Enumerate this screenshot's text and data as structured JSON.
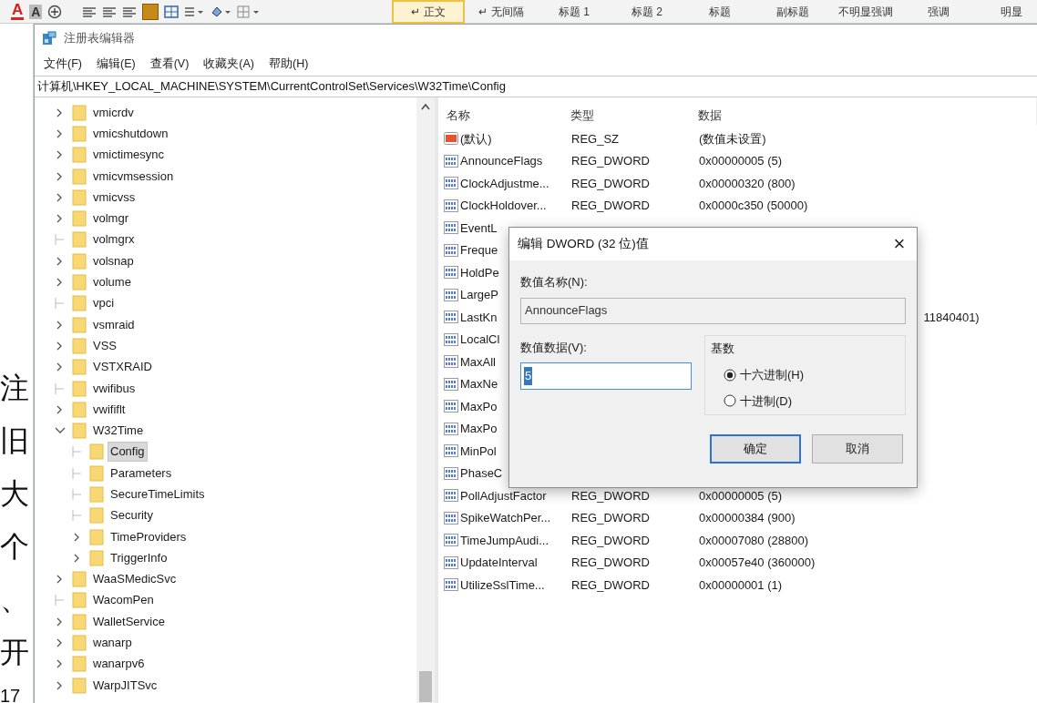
{
  "word_toolbar": {
    "glyph_buttons": [
      {
        "kind": "font-color",
        "glyph": "A"
      },
      {
        "kind": "shading",
        "glyph": "A"
      }
    ],
    "styles": [
      {
        "label": "正文",
        "prefix": "↵",
        "selected": true
      },
      {
        "label": "无间隔",
        "prefix": "↵",
        "selected": false
      },
      {
        "label": "标题 1",
        "selected": false
      },
      {
        "label": "标题 2",
        "selected": false
      },
      {
        "label": "标题",
        "selected": false
      },
      {
        "label": "副标题",
        "selected": false
      },
      {
        "label": "不明显强调",
        "selected": false
      },
      {
        "label": "强调",
        "selected": false
      },
      {
        "label": "明显",
        "selected": false
      }
    ]
  },
  "document_fragments": [
    "注",
    "旧",
    "大",
    "个",
    "、",
    "开",
    "17"
  ],
  "window": {
    "title": "注册表编辑器",
    "menu": [
      "文件(F)",
      "编辑(E)",
      "查看(V)",
      "收藏夹(A)",
      "帮助(H)"
    ],
    "address": "计算机\\HKEY_LOCAL_MACHINE\\SYSTEM\\CurrentControlSet\\Services\\W32Time\\Config",
    "tree": [
      {
        "kind": "branch",
        "label": "vmicrdv",
        "expanded": false,
        "selected": false
      },
      {
        "kind": "branch",
        "label": "vmicshutdown",
        "expanded": false,
        "selected": false
      },
      {
        "kind": "branch",
        "label": "vmictimesync",
        "expanded": false,
        "selected": false
      },
      {
        "kind": "branch",
        "label": "vmicvmsession",
        "expanded": false,
        "selected": false
      },
      {
        "kind": "branch",
        "label": "vmicvss",
        "expanded": false,
        "selected": false
      },
      {
        "kind": "branch",
        "label": "volmgr",
        "expanded": false,
        "selected": false
      },
      {
        "kind": "leaf",
        "label": "volmgrx",
        "selected": false
      },
      {
        "kind": "branch",
        "label": "volsnap",
        "expanded": false,
        "selected": false
      },
      {
        "kind": "branch",
        "label": "volume",
        "expanded": false,
        "selected": false
      },
      {
        "kind": "leaf",
        "label": "vpci",
        "selected": false
      },
      {
        "kind": "branch",
        "label": "vsmraid",
        "expanded": false,
        "selected": false
      },
      {
        "kind": "branch",
        "label": "VSS",
        "expanded": false,
        "selected": false
      },
      {
        "kind": "branch",
        "label": "VSTXRAID",
        "expanded": false,
        "selected": false
      },
      {
        "kind": "leaf",
        "label": "vwifibus",
        "selected": false
      },
      {
        "kind": "branch",
        "label": "vwififlt",
        "expanded": false,
        "selected": false
      },
      {
        "kind": "branch",
        "label": "W32Time",
        "expanded": true,
        "selected": false,
        "children": [
          {
            "kind": "leaf",
            "label": "Config",
            "selected": true
          },
          {
            "kind": "leaf",
            "label": "Parameters",
            "selected": false
          },
          {
            "kind": "leaf",
            "label": "SecureTimeLimits",
            "selected": false
          },
          {
            "kind": "leaf",
            "label": "Security",
            "selected": false
          },
          {
            "kind": "branch",
            "label": "TimeProviders",
            "expanded": false,
            "selected": false
          },
          {
            "kind": "branch",
            "label": "TriggerInfo",
            "expanded": false,
            "selected": false
          }
        ]
      },
      {
        "kind": "branch",
        "label": "WaaSMedicSvc",
        "expanded": false,
        "selected": false
      },
      {
        "kind": "leaf",
        "label": "WacomPen",
        "selected": false
      },
      {
        "kind": "branch",
        "label": "WalletService",
        "expanded": false,
        "selected": false
      },
      {
        "kind": "branch",
        "label": "wanarp",
        "expanded": false,
        "selected": false
      },
      {
        "kind": "branch",
        "label": "wanarpv6",
        "expanded": false,
        "selected": false
      },
      {
        "kind": "branch",
        "label": "WarpJITSvc",
        "expanded": false,
        "selected": false
      }
    ],
    "list": {
      "columns": [
        "名称",
        "类型",
        "数据"
      ],
      "rows": [
        {
          "kind": "string",
          "name": "(默认)",
          "type": "REG_SZ",
          "data": "(数值未设置)"
        },
        {
          "kind": "dword",
          "name": "AnnounceFlags",
          "type": "REG_DWORD",
          "data": "0x00000005 (5)"
        },
        {
          "kind": "dword",
          "name": "ClockAdjustme...",
          "type": "REG_DWORD",
          "data": "0x00000320 (800)"
        },
        {
          "kind": "dword",
          "name": "ClockHoldover...",
          "type": "REG_DWORD",
          "data": "0x0000c350 (50000)"
        },
        {
          "kind": "dword",
          "name": "EventL"
        },
        {
          "kind": "dword",
          "name": "Freque"
        },
        {
          "kind": "dword",
          "name": "HoldPe"
        },
        {
          "kind": "dword",
          "name": "LargeP"
        },
        {
          "kind": "dword",
          "name": "LastKn",
          "data_tail": "11840401)"
        },
        {
          "kind": "dword",
          "name": "LocalCl"
        },
        {
          "kind": "dword",
          "name": "MaxAll"
        },
        {
          "kind": "dword",
          "name": "MaxNe"
        },
        {
          "kind": "dword",
          "name": "MaxPo"
        },
        {
          "kind": "dword",
          "name": "MaxPo"
        },
        {
          "kind": "dword",
          "name": "MinPol"
        },
        {
          "kind": "dword",
          "name": "PhaseC"
        },
        {
          "kind": "dword",
          "name": "PollAdjustFactor",
          "type": "REG_DWORD",
          "data": "0x00000005 (5)"
        },
        {
          "kind": "dword",
          "name": "SpikeWatchPer...",
          "type": "REG_DWORD",
          "data": "0x00000384 (900)"
        },
        {
          "kind": "dword",
          "name": "TimeJumpAudi...",
          "type": "REG_DWORD",
          "data": "0x00007080 (28800)"
        },
        {
          "kind": "dword",
          "name": "UpdateInterval",
          "type": "REG_DWORD",
          "data": "0x00057e40 (360000)"
        },
        {
          "kind": "dword",
          "name": "UtilizeSslTime...",
          "type": "REG_DWORD",
          "data": "0x00000001 (1)"
        }
      ]
    }
  },
  "dialog": {
    "title": "编辑 DWORD (32 位)值",
    "close": "×",
    "name_label": "数值名称(N):",
    "name_value": "AnnounceFlags",
    "data_label": "数值数据(V):",
    "data_value": "5",
    "base_label": "基数",
    "bases": [
      {
        "label": "十六进制(H)",
        "selected": true
      },
      {
        "label": "十进制(D)",
        "selected": false
      }
    ],
    "buttons": [
      {
        "label": "确定",
        "default": true
      },
      {
        "label": "取消",
        "default": false
      }
    ]
  }
}
